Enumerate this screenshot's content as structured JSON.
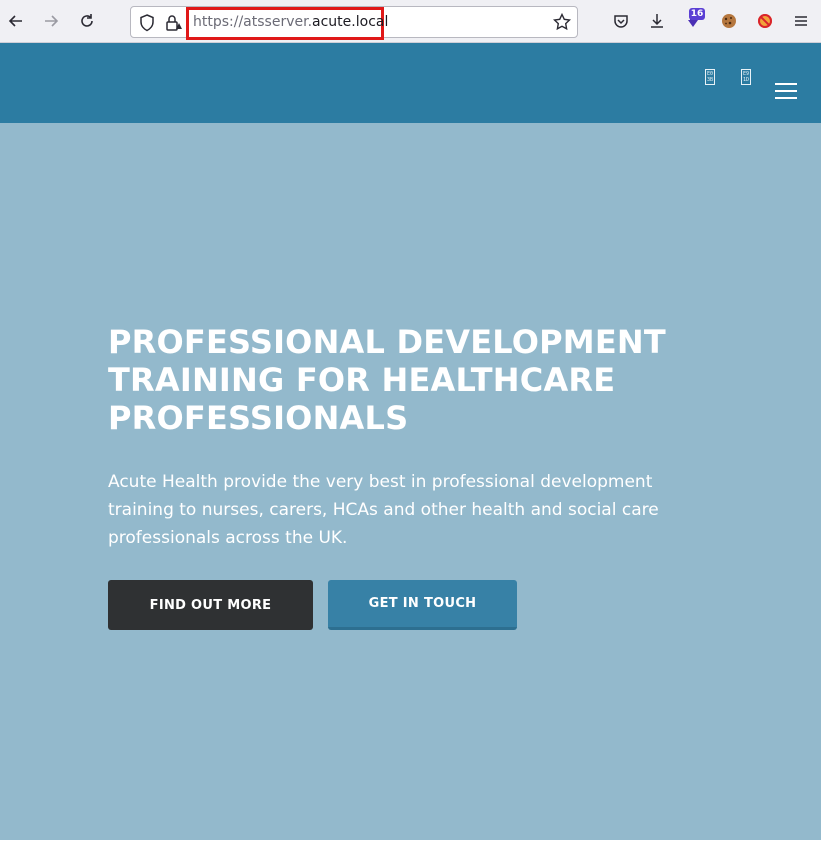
{
  "browser": {
    "url_prefix": "https://atsserver.",
    "url_domain": "acute.local",
    "extension_badge": "16",
    "icons": [
      "back-icon",
      "forward-icon",
      "reload-icon",
      "shield-icon",
      "lock-warning-icon",
      "star-icon",
      "pocket-icon",
      "download-icon",
      "extension-icon",
      "cookie-icon",
      "blocker-icon",
      "menu-icon"
    ]
  },
  "header": {
    "glyph_left": "E0 3B",
    "glyph_right": "E9 1D"
  },
  "hero": {
    "title": "PROFESSIONAL DEVELOPMENT TRAINING FOR HEALTHCARE PROFESSIONALS",
    "text": "Acute Health provide the very best in professional development training to nurses, carers, HCAs and other health and social care professionals across the UK.",
    "primary_button": "FIND OUT MORE",
    "secondary_button": "GET IN TOUCH"
  },
  "colors": {
    "header": "#2c7ca2",
    "hero": "#93b9cc",
    "dark_button": "#2f3133",
    "blue_button": "#3781a6",
    "highlight": "#e01818"
  }
}
